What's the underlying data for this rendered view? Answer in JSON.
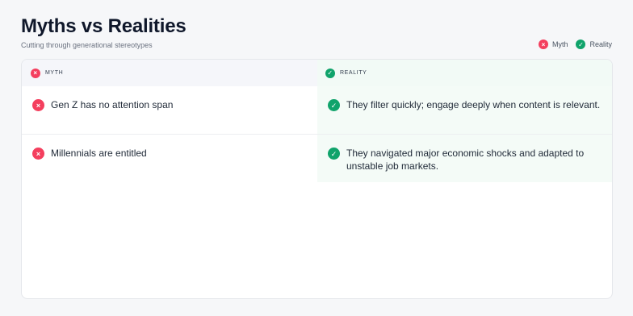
{
  "header": {
    "title": "Myths vs Realities",
    "subtitle": "Cutting through generational stereotypes"
  },
  "legend": {
    "myth_label": "Myth",
    "reality_label": "Reality"
  },
  "table": {
    "myth_header": "MYTH",
    "reality_header": "REALITY",
    "rows": [
      {
        "myth": "Gen Z has no attention span",
        "reality": "They filter quickly; engage deeply when content is relevant."
      },
      {
        "myth": "Millennials are entitled",
        "reality": "They navigated major economic shocks and adapted to unstable job markets."
      }
    ]
  },
  "icons": {
    "myth_icon": "x-circle-icon",
    "reality_icon": "check-circle-icon"
  },
  "colors": {
    "myth": "#f43f5e",
    "reality": "#10a36b"
  }
}
